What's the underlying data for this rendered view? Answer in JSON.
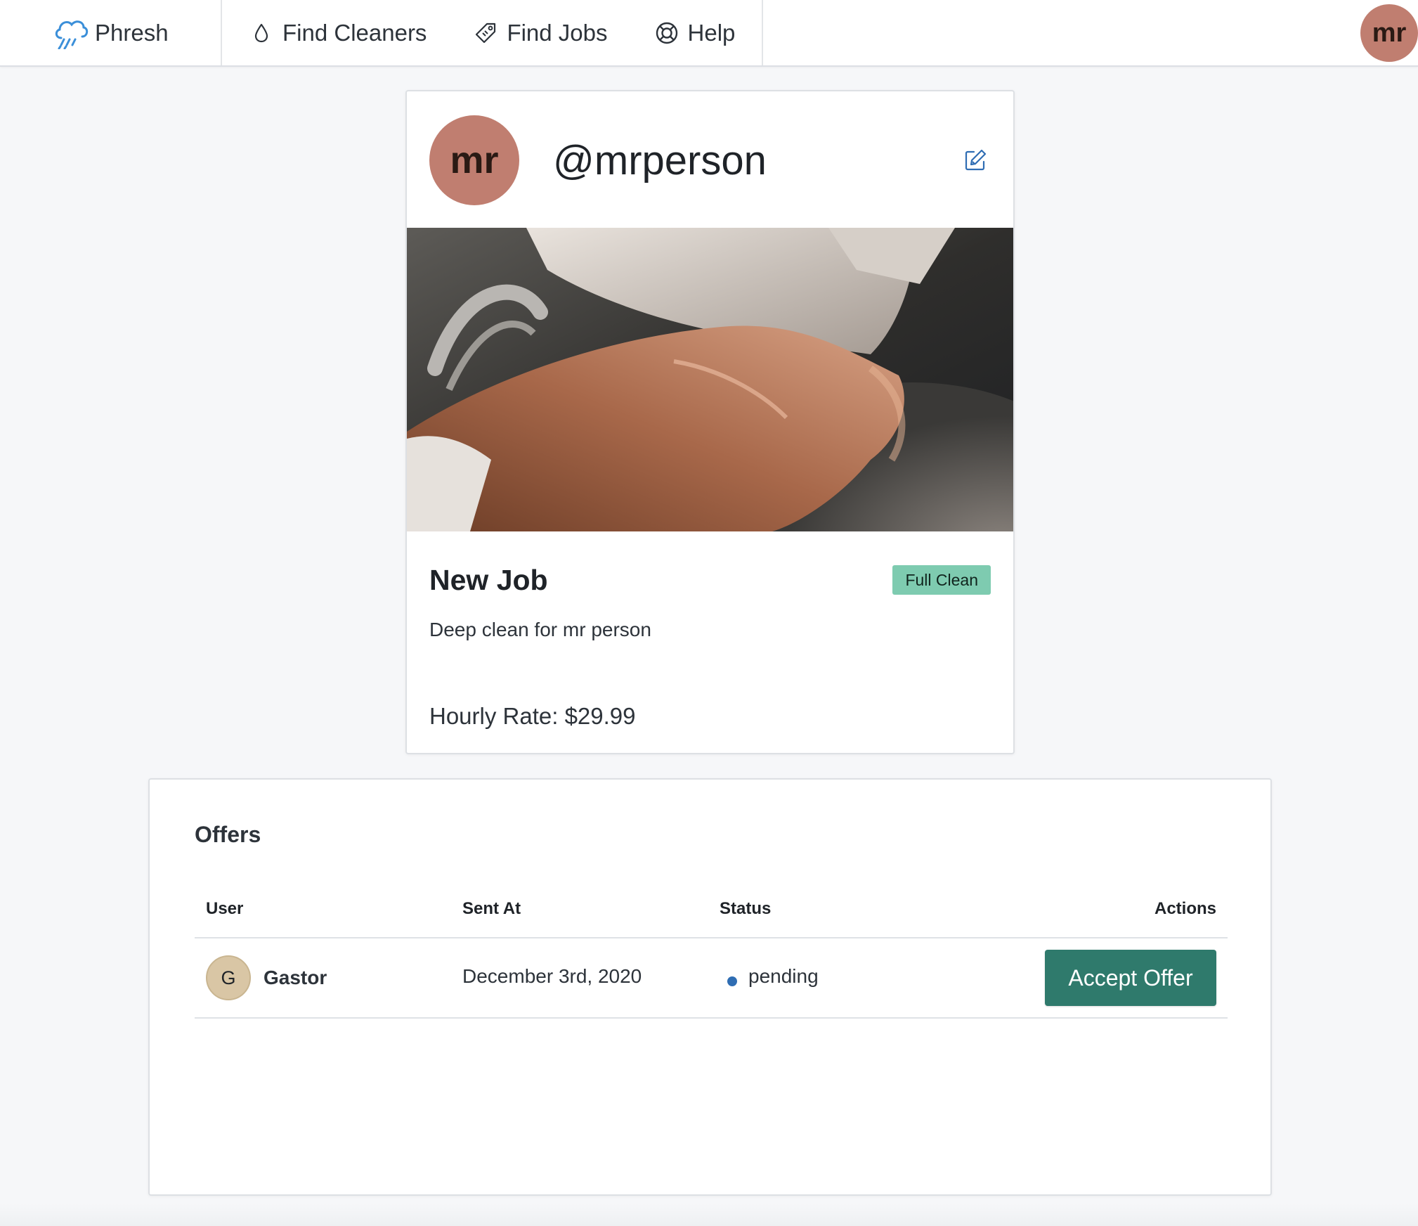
{
  "nav": {
    "brand": "Phresh",
    "links": [
      {
        "label": "Find Cleaners",
        "icon": "droplet-icon"
      },
      {
        "label": "Find Jobs",
        "icon": "tag-icon"
      },
      {
        "label": "Help",
        "icon": "lifebuoy-icon"
      }
    ],
    "avatar_initials": "mr"
  },
  "job": {
    "owner_initials": "mr",
    "owner_handle": "@mrperson",
    "image_alt": "hand cleaning a pot with a cloth",
    "title": "New Job",
    "tag": "Full Clean",
    "description": "Deep clean for mr person",
    "rate_text": "Hourly Rate: $29.99"
  },
  "offers": {
    "title": "Offers",
    "columns": [
      "User",
      "Sent At",
      "Status",
      "Actions"
    ],
    "rows": [
      {
        "initial": "G",
        "username": "Gastor",
        "sent_at": "December 3rd, 2020",
        "status": "pending",
        "action": "Accept Offer"
      }
    ]
  },
  "colors": {
    "accent": "#2f7a6c",
    "avatar": "#c07e70",
    "tag": "#7ecbb0",
    "status_pending": "#2f6db3",
    "brand_icon": "#3b8fd9"
  }
}
